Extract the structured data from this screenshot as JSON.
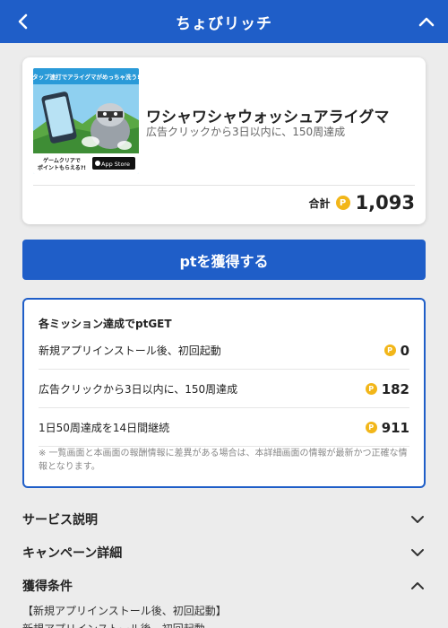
{
  "header": {
    "title": "ちょびリッチ",
    "back_icon": "chevron-left-icon",
    "collapse_icon": "chevron-up-icon",
    "bg_color": "#1f5ec8"
  },
  "offer": {
    "banner": {
      "top_text": "タップ連打でアライグマがめっちゃ洗う!",
      "bottom_text": "ゲームクリアで\nポイントもらえる?!",
      "badge": "App Store"
    },
    "app_name": "ワシャワシャウォッシュアライグマ",
    "description": "広告クリックから3日以内に、150周達成",
    "total_label": "合計",
    "total_points": "1,093",
    "coin_symbol": "P",
    "coin_color": "#f2b619"
  },
  "cta_label": "ptを獲得する",
  "missions": {
    "heading": "各ミッション達成でptGET",
    "items": [
      {
        "name": "新規アプリインストール後、初回起動",
        "points": "0"
      },
      {
        "name": "広告クリックから3日以内に、150周達成",
        "points": "182"
      },
      {
        "name": "1日50周達成を14日間継続",
        "points": "911"
      }
    ],
    "note": "※ 一覧画面と本画面の報酬情報に差異がある場合は、本詳細画面の情報が最新かつ正確な情報となります。"
  },
  "sections": [
    {
      "label": "サービス説明",
      "icon": "chevron-down-icon"
    },
    {
      "label": "キャンペーン詳細",
      "icon": "chevron-down-icon"
    },
    {
      "label": "獲得条件",
      "icon": "chevron-up-icon"
    }
  ],
  "conditions": {
    "line1": "【新規アプリインストール後、初回起動】",
    "line2": "新規アプリインストール後、初回起動"
  }
}
